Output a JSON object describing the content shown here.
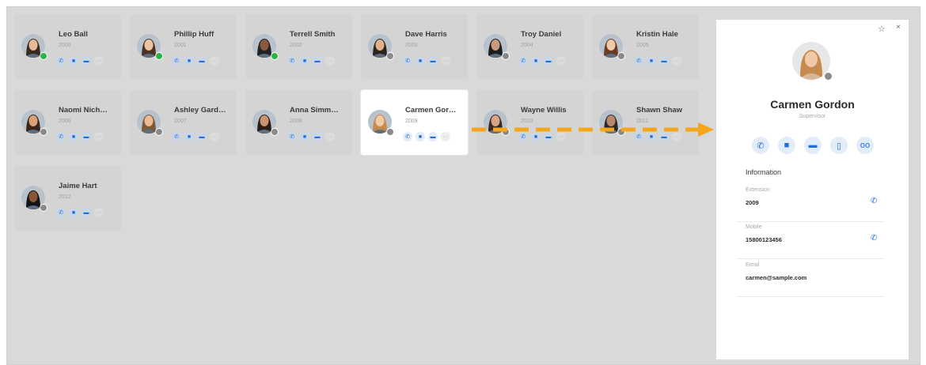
{
  "contacts": [
    {
      "name": "Leo Ball",
      "ext": "2000",
      "status": "online"
    },
    {
      "name": "Phillip Huff",
      "ext": "2001",
      "status": "online"
    },
    {
      "name": "Terrell Smith",
      "ext": "2002",
      "status": "online"
    },
    {
      "name": "Dave Harris",
      "ext": "2003",
      "status": "offline"
    },
    {
      "name": "Troy Daniel",
      "ext": "2004",
      "status": "offline"
    },
    {
      "name": "Kristin Hale",
      "ext": "2005",
      "status": "offline"
    },
    {
      "name": "Naomi Nich…",
      "ext": "2006",
      "status": "offline"
    },
    {
      "name": "Ashley Gard…",
      "ext": "2007",
      "status": "offline"
    },
    {
      "name": "Anna Simm…",
      "ext": "2008",
      "status": "offline"
    },
    {
      "name": "Carmen Gor…",
      "ext": "2009",
      "status": "offline",
      "selected": true
    },
    {
      "name": "Wayne Willis",
      "ext": "2010",
      "status": "offline"
    },
    {
      "name": "Shawn Shaw",
      "ext": "2011",
      "status": "offline"
    },
    {
      "name": "Jaime Hart",
      "ext": "2012",
      "status": "offline"
    }
  ],
  "card_actions": {
    "call": "✆",
    "video": "■",
    "chat": "▬",
    "more": "···"
  },
  "panel": {
    "star_icon": "☆",
    "close_icon": "×",
    "name": "Carmen Gordon",
    "role": "Supervisor",
    "actions": {
      "call": "✆",
      "video": "■",
      "chat": "▬",
      "mobile": "▯",
      "voicemail": "oo"
    },
    "info_title": "Information",
    "extension_label": "Extension",
    "extension_value": "2009",
    "mobile_label": "Mobile",
    "mobile_value": "15800123456",
    "email_label": "Email",
    "email_value": "carmen@sample.com",
    "phone_icon": "✆"
  },
  "colors": {
    "accent": "#1e6fd9",
    "online": "#2fb344",
    "offline": "#8a8a8a",
    "arrow": "#f4a61c",
    "background": "#d9d9d9"
  }
}
